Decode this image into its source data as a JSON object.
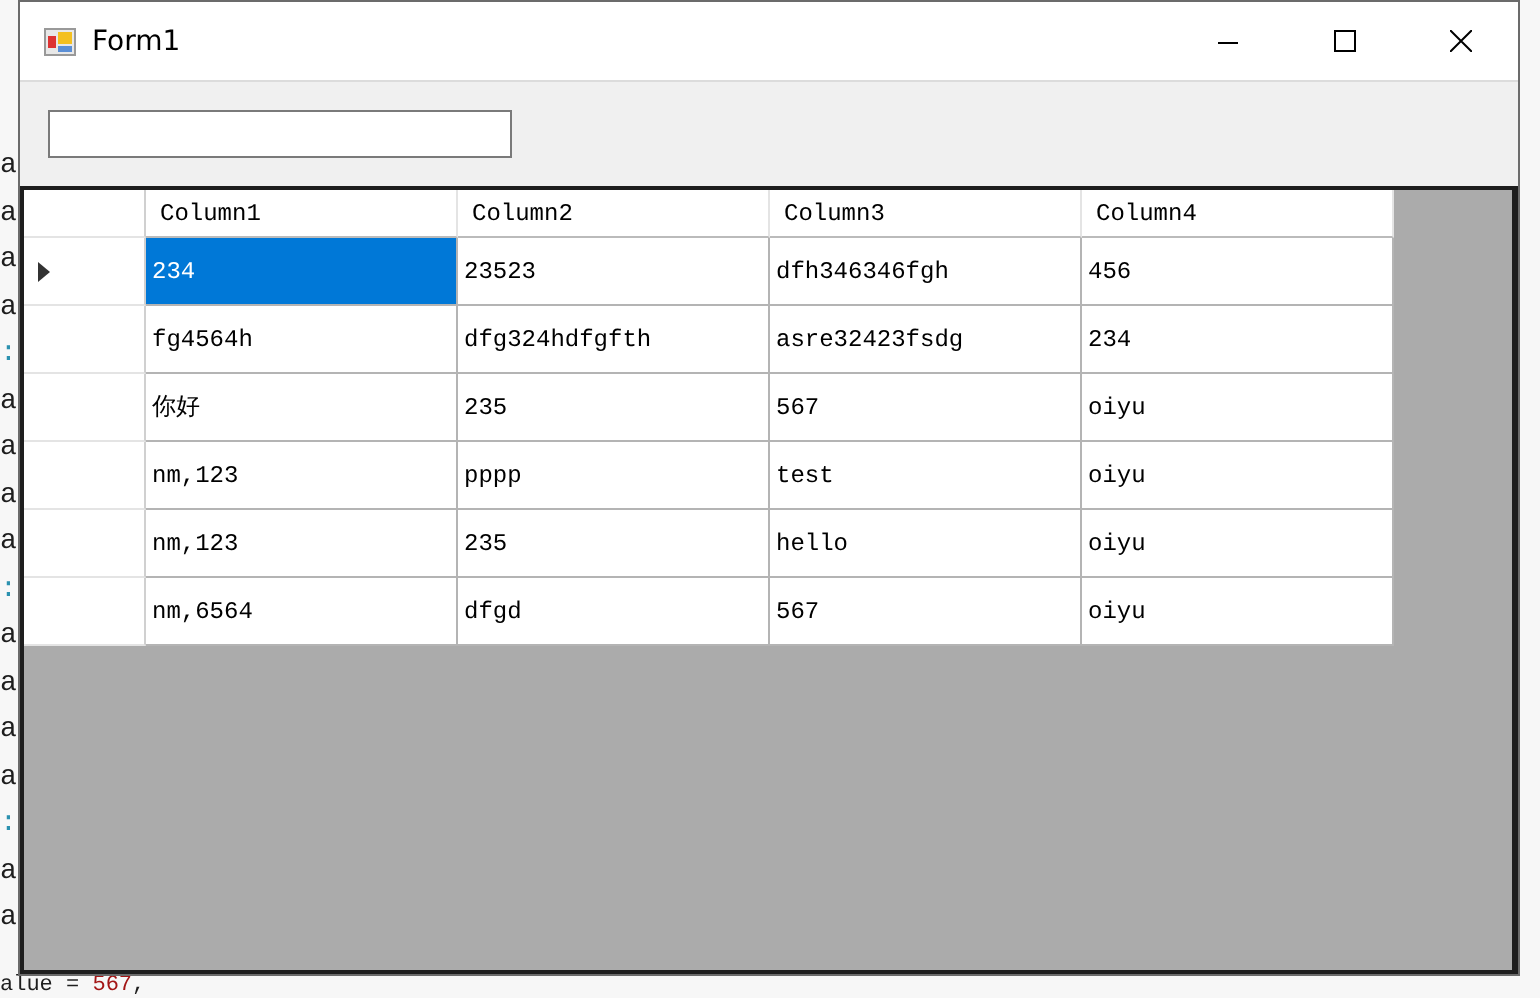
{
  "background_code": {
    "side_lines": [
      {
        "text": "a",
        "kind": "plain"
      },
      {
        "text": "a",
        "kind": "plain"
      },
      {
        "text": "a",
        "kind": "plain"
      },
      {
        "text": "a",
        "kind": "plain"
      },
      {
        "text": ":",
        "kind": "keyword"
      },
      {
        "text": "a",
        "kind": "plain"
      },
      {
        "text": "a",
        "kind": "plain"
      },
      {
        "text": "a",
        "kind": "plain"
      },
      {
        "text": "a",
        "kind": "plain"
      },
      {
        "text": ":",
        "kind": "keyword"
      },
      {
        "text": "a",
        "kind": "plain"
      },
      {
        "text": "a",
        "kind": "plain"
      },
      {
        "text": "a",
        "kind": "plain"
      },
      {
        "text": "a",
        "kind": "plain"
      },
      {
        "text": ":",
        "kind": "keyword"
      },
      {
        "text": "a",
        "kind": "plain"
      },
      {
        "text": "a",
        "kind": "plain"
      }
    ],
    "bottom_line": {
      "name": "alue = ",
      "value": "567",
      "tail": ","
    }
  },
  "window": {
    "title": "Form1"
  },
  "grid": {
    "columns": [
      "Column1",
      "Column2",
      "Column3",
      "Column4"
    ],
    "rows": [
      {
        "current": true,
        "cells": [
          {
            "text": "234",
            "selected": true
          },
          {
            "text": "23523",
            "selected": false
          },
          {
            "text": "dfh346346fgh",
            "selected": false
          },
          {
            "text": "456",
            "selected": false
          }
        ]
      },
      {
        "current": false,
        "cells": [
          {
            "text": "fg4564h",
            "selected": false
          },
          {
            "text": "dfg324hdfgfth",
            "selected": false
          },
          {
            "text": "asre32423fsdg",
            "selected": false
          },
          {
            "text": "234",
            "selected": false
          }
        ]
      },
      {
        "current": false,
        "cells": [
          {
            "text": "你好",
            "selected": false
          },
          {
            "text": "235",
            "selected": false
          },
          {
            "text": "567",
            "selected": false
          },
          {
            "text": "oiyu",
            "selected": false
          }
        ]
      },
      {
        "current": false,
        "cells": [
          {
            "text": "nm,123",
            "selected": false
          },
          {
            "text": "pppp",
            "selected": false
          },
          {
            "text": "test",
            "selected": false
          },
          {
            "text": "oiyu",
            "selected": false
          }
        ]
      },
      {
        "current": false,
        "cells": [
          {
            "text": "nm,123",
            "selected": false
          },
          {
            "text": "235",
            "selected": false
          },
          {
            "text": "hello",
            "selected": false
          },
          {
            "text": "oiyu",
            "selected": false
          }
        ]
      },
      {
        "current": false,
        "cells": [
          {
            "text": "nm,6564",
            "selected": false
          },
          {
            "text": "dfgd",
            "selected": false
          },
          {
            "text": "567",
            "selected": false
          },
          {
            "text": "oiyu",
            "selected": false
          }
        ]
      }
    ]
  }
}
